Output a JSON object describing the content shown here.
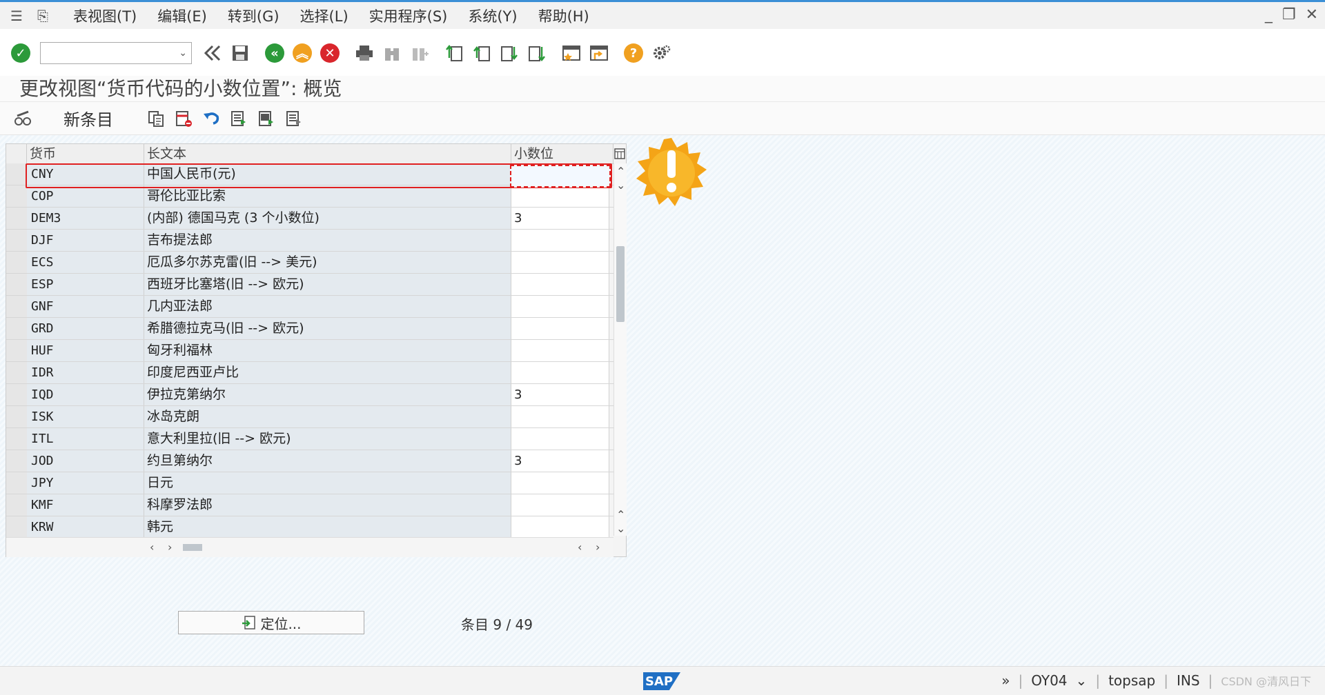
{
  "menu": {
    "items": [
      "表视图(T)",
      "编辑(E)",
      "转到(G)",
      "选择(L)",
      "实用程序(S)",
      "系统(Y)",
      "帮助(H)"
    ]
  },
  "page": {
    "title": "更改视图“货币代码的小数位置”: 概览"
  },
  "app_toolbar": {
    "new_entry_label": "新条目"
  },
  "table": {
    "headers": [
      "货币",
      "长文本",
      "小数位"
    ],
    "rows": [
      {
        "code": "CNY",
        "text": "中国人民币(元)",
        "decimals": ""
      },
      {
        "code": "COP",
        "text": "哥伦比亚比索",
        "decimals": ""
      },
      {
        "code": "DEM3",
        "text": "(内部) 德国马克 (3 个小数位)",
        "decimals": "3"
      },
      {
        "code": "DJF",
        "text": "吉布提法郎",
        "decimals": ""
      },
      {
        "code": "ECS",
        "text": "厄瓜多尔苏克雷(旧 --> 美元)",
        "decimals": ""
      },
      {
        "code": "ESP",
        "text": "西班牙比塞塔(旧 --> 欧元)",
        "decimals": ""
      },
      {
        "code": "GNF",
        "text": "几内亚法郎",
        "decimals": ""
      },
      {
        "code": "GRD",
        "text": "希腊德拉克马(旧 --> 欧元)",
        "decimals": ""
      },
      {
        "code": "HUF",
        "text": "匈牙利福林",
        "decimals": ""
      },
      {
        "code": "IDR",
        "text": "印度尼西亚卢比",
        "decimals": ""
      },
      {
        "code": "IQD",
        "text": "伊拉克第纳尔",
        "decimals": "3"
      },
      {
        "code": "ISK",
        "text": "冰岛克朗",
        "decimals": ""
      },
      {
        "code": "ITL",
        "text": "意大利里拉(旧 --> 欧元)",
        "decimals": ""
      },
      {
        "code": "JOD",
        "text": "约旦第纳尔",
        "decimals": "3"
      },
      {
        "code": "JPY",
        "text": "日元",
        "decimals": ""
      },
      {
        "code": "KMF",
        "text": "科摩罗法郎",
        "decimals": ""
      },
      {
        "code": "KRW",
        "text": "韩元",
        "decimals": ""
      }
    ]
  },
  "footer": {
    "locate_label": "定位...",
    "entry_label": "条目 9 / 49"
  },
  "status": {
    "sap": "SAP",
    "transaction": "OY04",
    "server": "topsap",
    "mode": "INS",
    "watermark": "CSDN @清风日下"
  },
  "colors": {
    "accent": "#3b8fd6",
    "ok_green": "#2c9a3a",
    "cancel_red": "#d9262c",
    "exit_orange": "#f0a020",
    "highlight": "#e02020"
  }
}
